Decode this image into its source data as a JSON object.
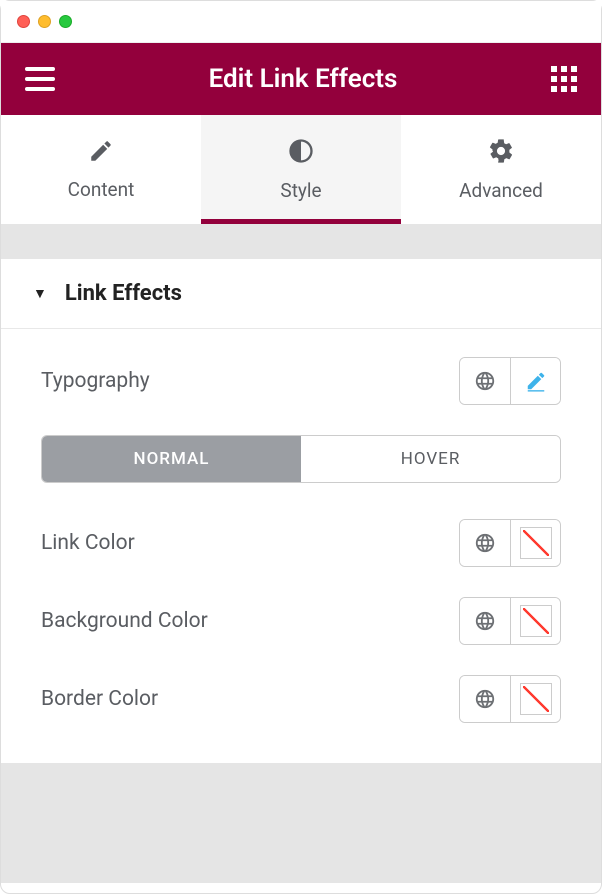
{
  "header": {
    "title": "Edit Link Effects"
  },
  "tabs": {
    "content": "Content",
    "style": "Style",
    "advanced": "Advanced",
    "active": "style"
  },
  "section": {
    "title": "Link Effects"
  },
  "typography": {
    "label": "Typography"
  },
  "state_toggle": {
    "normal": "NORMAL",
    "hover": "HOVER",
    "active": "normal"
  },
  "color_rows": {
    "link": "Link Color",
    "background": "Background Color",
    "border": "Border Color"
  }
}
